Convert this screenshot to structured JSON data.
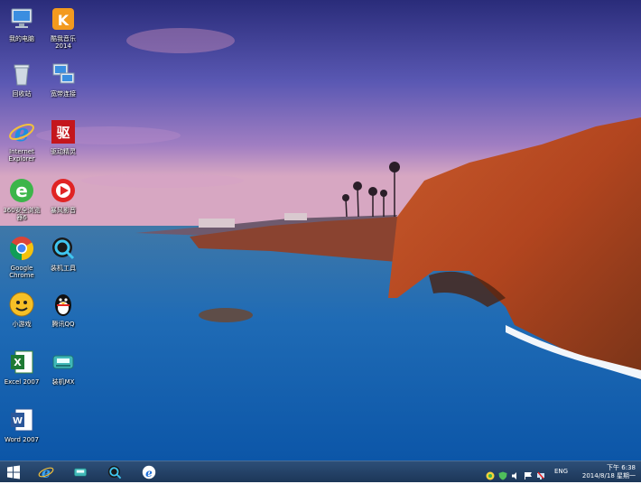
{
  "desktop_icons": [
    {
      "id": "computer",
      "label": "我的电脑",
      "icon": "computer-icon"
    },
    {
      "id": "kugou",
      "label": "酷我音乐\n2014",
      "icon": "kuwo-music-icon"
    },
    {
      "id": "recycle",
      "label": "回收站",
      "icon": "recycle-bin-icon"
    },
    {
      "id": "network",
      "label": "宽带连接",
      "icon": "broadband-connection-icon"
    },
    {
      "id": "ie",
      "label": "Internet\nExplorer",
      "icon": "internet-explorer-icon"
    },
    {
      "id": "driver",
      "label": "驱动精灵",
      "icon": "driver-genius-icon"
    },
    {
      "id": "se360",
      "label": "360安全浏览\n器6",
      "icon": "360-browser-icon"
    },
    {
      "id": "baofeng",
      "label": "暴风影音",
      "icon": "storm-player-icon"
    },
    {
      "id": "chrome",
      "label": "Google\nChrome",
      "icon": "chrome-icon"
    },
    {
      "id": "tools",
      "label": "装机工具",
      "icon": "install-tools-icon"
    },
    {
      "id": "game",
      "label": "小游戏",
      "icon": "mini-game-icon"
    },
    {
      "id": "qq",
      "label": "腾讯QQ",
      "icon": "qq-penguin-icon"
    },
    {
      "id": "excel",
      "label": "Excel 2007",
      "icon": "excel-icon"
    },
    {
      "id": "wuliu",
      "label": "装机MX",
      "icon": "mx-tool-icon"
    },
    {
      "id": "word",
      "label": "Word 2007",
      "icon": "word-icon"
    }
  ],
  "taskbar": {
    "pinned": [
      "start-button",
      "internet-explorer-icon",
      "mx-tool-icon",
      "install-tools-icon",
      "ie-alt-icon"
    ],
    "tray": {
      "language": "ENG",
      "time": "下午 6:38",
      "date": "2014/8/18 星期一"
    }
  },
  "colors": {
    "taskbar": "#1c3658",
    "accent": "#2f6fb3"
  }
}
